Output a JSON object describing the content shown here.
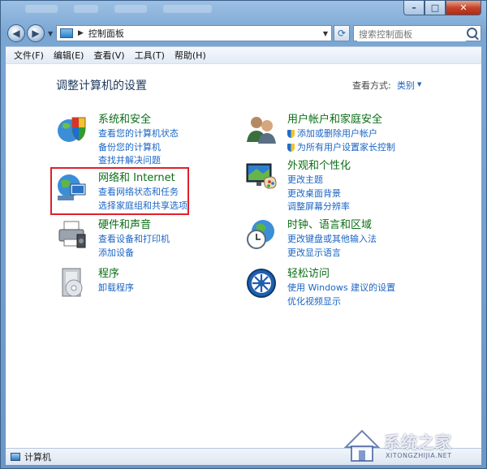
{
  "address": {
    "path": "控制面板"
  },
  "search": {
    "placeholder": "搜索控制面板"
  },
  "caption": {
    "min": "–",
    "max": "□",
    "close": "✕"
  },
  "menu": [
    "文件(F)",
    "编辑(E)",
    "查看(V)",
    "工具(T)",
    "帮助(H)"
  ],
  "page": {
    "title": "调整计算机的设置",
    "view_by_label": "查看方式:",
    "view_by_value": "类别"
  },
  "categories": [
    {
      "icon": "shield-globe-icon",
      "title": "系统和安全",
      "links": [
        "查看您的计算机状态",
        "备份您的计算机",
        "查找并解决问题"
      ]
    },
    {
      "icon": "network-globe-icon",
      "title": "网络和 Internet",
      "links": [
        "查看网络状态和任务",
        "选择家庭组和共享选项"
      ]
    },
    {
      "icon": "printer-icon",
      "title": "硬件和声音",
      "links": [
        "查看设备和打印机",
        "添加设备"
      ]
    },
    {
      "icon": "programs-icon",
      "title": "程序",
      "links": [
        "卸载程序"
      ]
    },
    {
      "icon": "users-icon",
      "title": "用户帐户和家庭安全",
      "links": [
        "添加或删除用户帐户",
        "为所有用户设置家长控制"
      ]
    },
    {
      "icon": "monitor-palette-icon",
      "title": "外观和个性化",
      "links": [
        "更改主题",
        "更改桌面背景",
        "调整屏幕分辨率"
      ]
    },
    {
      "icon": "clock-globe-icon",
      "title": "时钟、语言和区域",
      "links": [
        "更改键盘或其他输入法",
        "更改显示语言"
      ]
    },
    {
      "icon": "ease-of-access-icon",
      "title": "轻松访问",
      "links": [
        "使用 Windows 建议的设置",
        "优化视频显示"
      ]
    }
  ],
  "status": {
    "text": "计算机"
  },
  "watermark": {
    "text": "系统之家",
    "url": "XITONGZHIJIA.NET"
  }
}
